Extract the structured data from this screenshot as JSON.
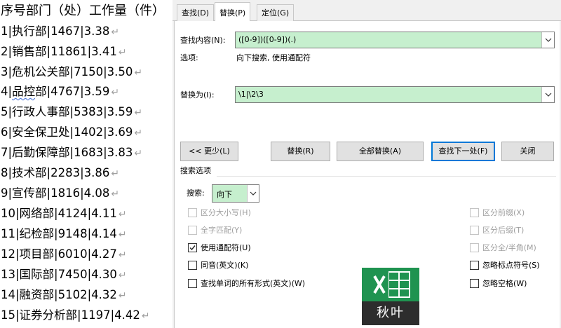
{
  "document": {
    "header": "序号部门（处）工作量（件）",
    "rows": [
      {
        "pre": "1|执行部|1467|3.38",
        "ul": "",
        "post": ""
      },
      {
        "pre": "2|销售部|11861|3.41",
        "ul": "",
        "post": ""
      },
      {
        "pre": "3|危机公关部|7150|3.50",
        "ul": "",
        "post": ""
      },
      {
        "pre": "4|",
        "ul": "品控",
        "post": "部|4767|3.59"
      },
      {
        "pre": "5|行政人事部|5383|3.59",
        "ul": "",
        "post": ""
      },
      {
        "pre": "6|安全保卫处|1402|3.69",
        "ul": "",
        "post": ""
      },
      {
        "pre": "7|后勤保障部|1683|3.83",
        "ul": "",
        "post": ""
      },
      {
        "pre": "8|技术部|2283|3.86",
        "ul": "",
        "post": ""
      },
      {
        "pre": "9|宣传部|1816|4.08",
        "ul": "",
        "post": ""
      },
      {
        "pre": "10|网络部|4124|4.11",
        "ul": "",
        "post": ""
      },
      {
        "pre": "11|纪检部|9148|4.14",
        "ul": "",
        "post": ""
      },
      {
        "pre": "12|项目部|6010|4.27",
        "ul": "",
        "post": ""
      },
      {
        "pre": "13|国际部|7450|4.30",
        "ul": "",
        "post": ""
      },
      {
        "pre": "14|融资部|5102|4.32",
        "ul": "",
        "post": ""
      },
      {
        "pre": "15|证券分析部|1197|4.42",
        "ul": "",
        "post": ""
      }
    ],
    "paragraph_mark": "↵"
  },
  "dialog": {
    "tabs": [
      "查找(D)",
      "替换(P)",
      "定位(G)"
    ],
    "active_tab": 1,
    "find_label": "查找内容(N):",
    "find_value": "([0-9])([0-9])(.)",
    "options_label": "选项:",
    "options_value": "向下搜索, 使用通配符",
    "replace_label": "替换为(I):",
    "replace_value": "\\1|\\2\\3",
    "buttons": {
      "less": "<< 更少(L)",
      "replace": "替换(R)",
      "replace_all": "全部替换(A)",
      "find_next": "查找下一处(F)",
      "close": "关闭"
    },
    "search_options_title": "搜索选项",
    "search_label": "搜索:",
    "search_value": "向下",
    "left_options": [
      {
        "label": "区分大小写(H)",
        "checked": false,
        "disabled": true
      },
      {
        "label": "全字匹配(Y)",
        "checked": false,
        "disabled": true
      },
      {
        "label": "使用通配符(U)",
        "checked": true,
        "disabled": false
      },
      {
        "label": "同音(英文)(K)",
        "checked": false,
        "disabled": false
      },
      {
        "label": "查找单词的所有形式(英文)(W)",
        "checked": false,
        "disabled": false
      }
    ],
    "right_options": [
      {
        "label": "区分前缀(X)",
        "checked": false,
        "disabled": true
      },
      {
        "label": "区分后缀(T)",
        "checked": false,
        "disabled": true
      },
      {
        "label": "区分全/半角(M)",
        "checked": false,
        "disabled": true
      },
      {
        "label": "忽略标点符号(S)",
        "checked": false,
        "disabled": false
      },
      {
        "label": "忽略空格(W)",
        "checked": false,
        "disabled": false
      }
    ]
  },
  "logo": {
    "text": "秋叶",
    "brand_color": "#1f9350"
  },
  "colors": {
    "combo_bg": "#c6efce",
    "accent": "#0078d7"
  }
}
